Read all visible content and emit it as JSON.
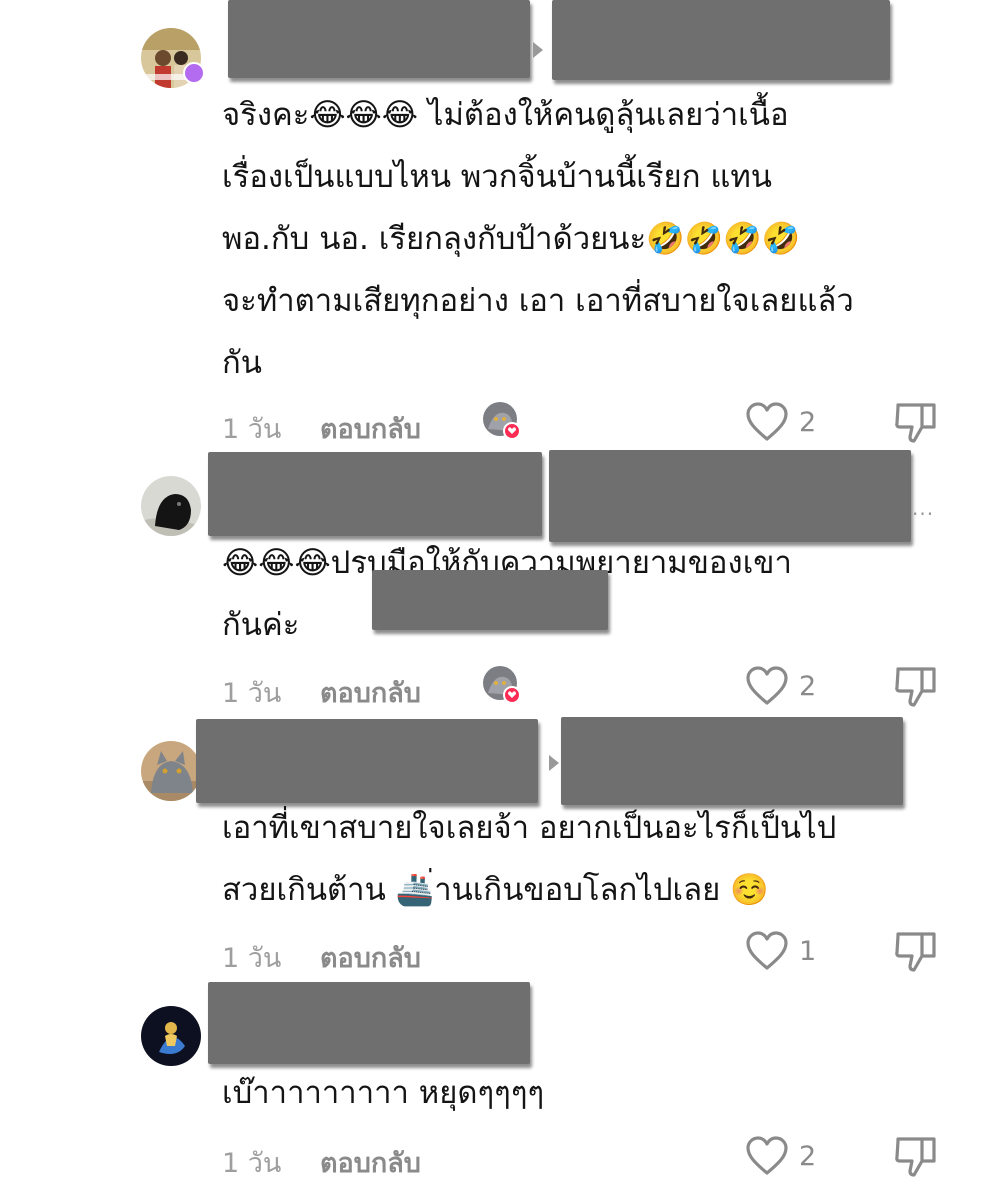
{
  "comments": [
    {
      "text": "จริงคะ😂😂😂 ไม่ต้องให้คนดูลุ้นเลยว่าเนื้อ\nเรื่องเป็นแบบไหน พวกจิ้นบ้านนี้เรียก แทน\nพอ.กับ นอ. เรียกลุงกับป้าด้วยนะ🤣🤣🤣🤣\nจะทำตามเสียทุกอย่าง เอา เอาที่สบายใจเลยแล้ว\nกัน",
      "time": "1 วัน",
      "reply_label": "ตอบกลับ",
      "likes": "2",
      "avatar_icon": "user-avatar-photo-icon",
      "has_reactor": true
    },
    {
      "text": "😂😂😂ปรบมือให้กับความพยายามของเขา\nกันค่ะ",
      "time": "1 วัน",
      "reply_label": "ตอบกลับ",
      "likes": "2",
      "avatar_icon": "user-avatar-black-bird-icon",
      "has_reactor": true,
      "more_label": "..."
    },
    {
      "text": "เอาที่เขาสบายใจเลยจ้า อยากเป็นอะไรก็เป็นไป\nสวยเกินต้าน 🚢่านเกินขอบโลกไปเลย ☺️",
      "time": "1 วัน",
      "reply_label": "ตอบกลับ",
      "likes": "1",
      "avatar_icon": "user-avatar-gray-cat-icon",
      "has_reactor": false
    },
    {
      "text": "เบ๊าาาาาาาาา หยุดๆๆๆๆ",
      "time": "1 วัน",
      "reply_label": "ตอบกลับ",
      "likes": "2",
      "avatar_icon": "user-avatar-dark-icon",
      "has_reactor": false
    }
  ],
  "colors": {
    "redaction": "#6f6f6f",
    "meta_text": "#8a8a8a",
    "heart_badge": "#fe2c55"
  },
  "icons": {
    "like": "heart-outline-icon",
    "dislike": "thumbs-down-outline-icon",
    "reactor": "creator-liked-avatar-icon"
  }
}
